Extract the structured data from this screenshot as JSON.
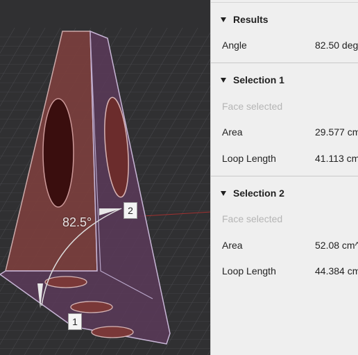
{
  "viewport": {
    "angle_label": "82.5°",
    "markers": [
      "1",
      "2"
    ]
  },
  "results": {
    "title": "Results",
    "angle_label": "Angle",
    "angle_value": "82.50 deg"
  },
  "selection1": {
    "title": "Selection 1",
    "status": "Face selected",
    "area_label": "Area",
    "area_value": "29.577 cm",
    "loop_label": "Loop Length",
    "loop_value": "41.113 cm"
  },
  "selection2": {
    "title": "Selection 2",
    "status": "Face selected",
    "area_label": "Area",
    "area_value": "52.08 cm^",
    "loop_label": "Loop Length",
    "loop_value": "44.384 cm"
  },
  "colors": {
    "face_primary": "#7a3f3c",
    "face_secondary": "#5a3a55",
    "outline": "#c9b8d8",
    "panel_bg": "#efefef"
  }
}
